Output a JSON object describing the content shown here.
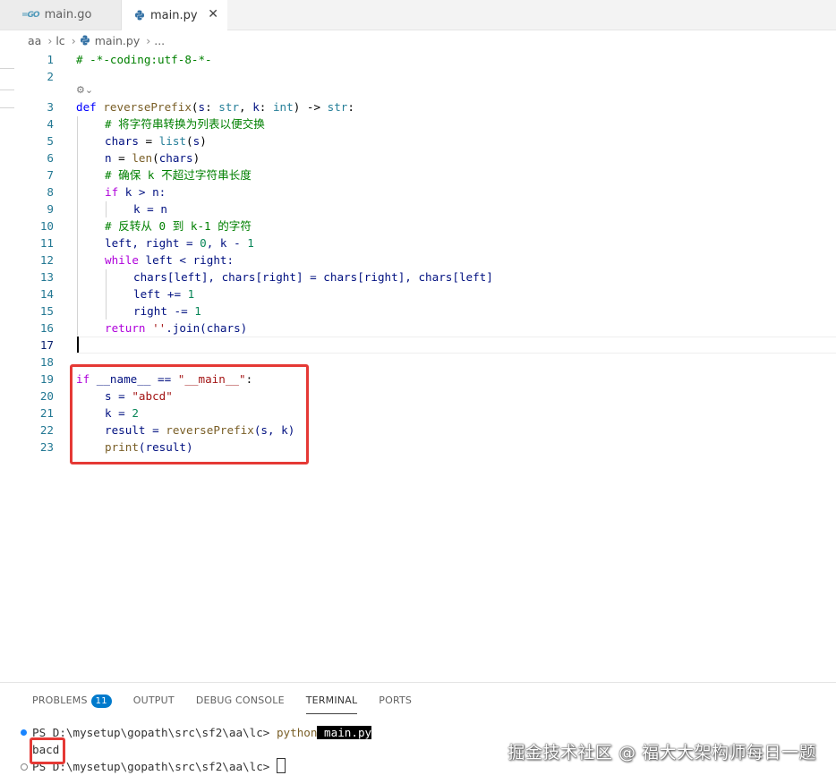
{
  "tabs": [
    {
      "label": "main.go",
      "icon": "go-icon"
    },
    {
      "label": "main.py",
      "icon": "python-icon",
      "close": "✕"
    }
  ],
  "breadcrumb": [
    "aa",
    "lc",
    "main.py",
    "..."
  ],
  "editor": {
    "line_numbers": [
      "1",
      "2",
      "3",
      "4",
      "5",
      "6",
      "7",
      "8",
      "9",
      "10",
      "11",
      "12",
      "13",
      "14",
      "15",
      "16",
      "17",
      "18",
      "19",
      "20",
      "21",
      "22",
      "23"
    ],
    "code": {
      "l1": "# -*-coding:utf-8-*-",
      "l3_def": "def",
      "l3_name": "reversePrefix",
      "l3_s": "s",
      "l3_str": "str",
      "l3_k": "k",
      "l3_int": "int",
      "l3_ret": "str",
      "l4": "# 将字符串转换为列表以便交换",
      "l5_a": "chars",
      "l5_fn": "list",
      "l5_arg": "s",
      "l6_a": "n",
      "l6_fn": "len",
      "l6_arg": "chars",
      "l7": "# 确保 k 不超过字符串长度",
      "l8_if": "if",
      "l8_rest": " k > n:",
      "l9": "k = n",
      "l10": "# 反转从 0 到 k-1 的字符",
      "l11_a": "left, right = ",
      "l11_n0": "0",
      "l11_b": ", k - ",
      "l11_n1": "1",
      "l12_kw": "while",
      "l12_rest": " left < right:",
      "l13": "chars[left], chars[right] = chars[right], chars[left]",
      "l14_a": "left += ",
      "l14_n": "1",
      "l15_a": "right -= ",
      "l15_n": "1",
      "l16_kw": "return",
      "l16_str": " ''",
      "l16_rest": ".join(chars)",
      "l19_if": "if",
      "l19_a": " __name__ == ",
      "l19_str": "\"__main__\"",
      "l19_b": ":",
      "l20_a": "s = ",
      "l20_str": "\"abcd\"",
      "l21_a": "k = ",
      "l21_n": "2",
      "l22_a": "result = ",
      "l22_fn": "reversePrefix",
      "l22_b": "(s, k)",
      "l23_fn": "print",
      "l23_b": "(result)"
    }
  },
  "panel": {
    "tabs": [
      "PROBLEMS",
      "OUTPUT",
      "DEBUG CONSOLE",
      "TERMINAL",
      "PORTS"
    ],
    "problems_count": "11",
    "active_tab": "TERMINAL",
    "terminal": {
      "prompt1": "PS D:\\mysetup\\gopath\\src\\sf2\\aa\\lc> ",
      "cmd": "python",
      "arg": " main.py",
      "output": "bacd",
      "prompt2": "PS D:\\mysetup\\gopath\\src\\sf2\\aa\\lc> "
    }
  },
  "watermark": "掘金技术社区 @ 福大大架构师每日一题",
  "colors": {
    "highlight_box": "#e53935",
    "badge": "#007acc"
  }
}
